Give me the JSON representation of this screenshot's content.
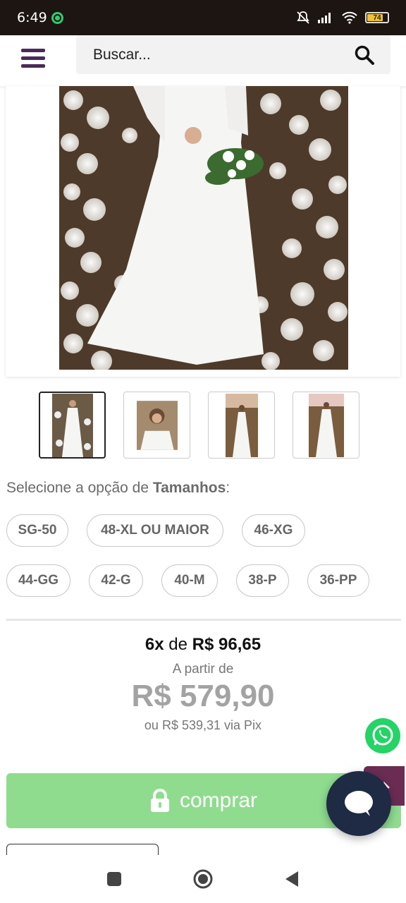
{
  "status_bar": {
    "time": "6:49",
    "battery": "74"
  },
  "header": {
    "search_placeholder": "Buscar..."
  },
  "product": {
    "option_prefix": "Selecione a opção de ",
    "option_name": "Tamanhos",
    "option_suffix": ":",
    "sizes_row1": [
      "SG-50",
      "48-XL OU MAIOR",
      "46-XG"
    ],
    "sizes_row2": [
      "44-GG",
      "42-G",
      "40-M",
      "38-P",
      "36-PP"
    ],
    "installments_count": "6x",
    "installments_mid": " de ",
    "installments_value": "R$ 96,65",
    "from_label": "A partir de",
    "price": "R$ 579,90",
    "pix_prefix": "ou ",
    "pix_value": "R$ 539,31",
    "pix_suffix": " via Pix",
    "buy_label": "comprar"
  },
  "colors": {
    "accent": "#4a2a57",
    "buy": "#8fdc8f",
    "whatsapp": "#25d366",
    "chat": "#1f2a44"
  }
}
